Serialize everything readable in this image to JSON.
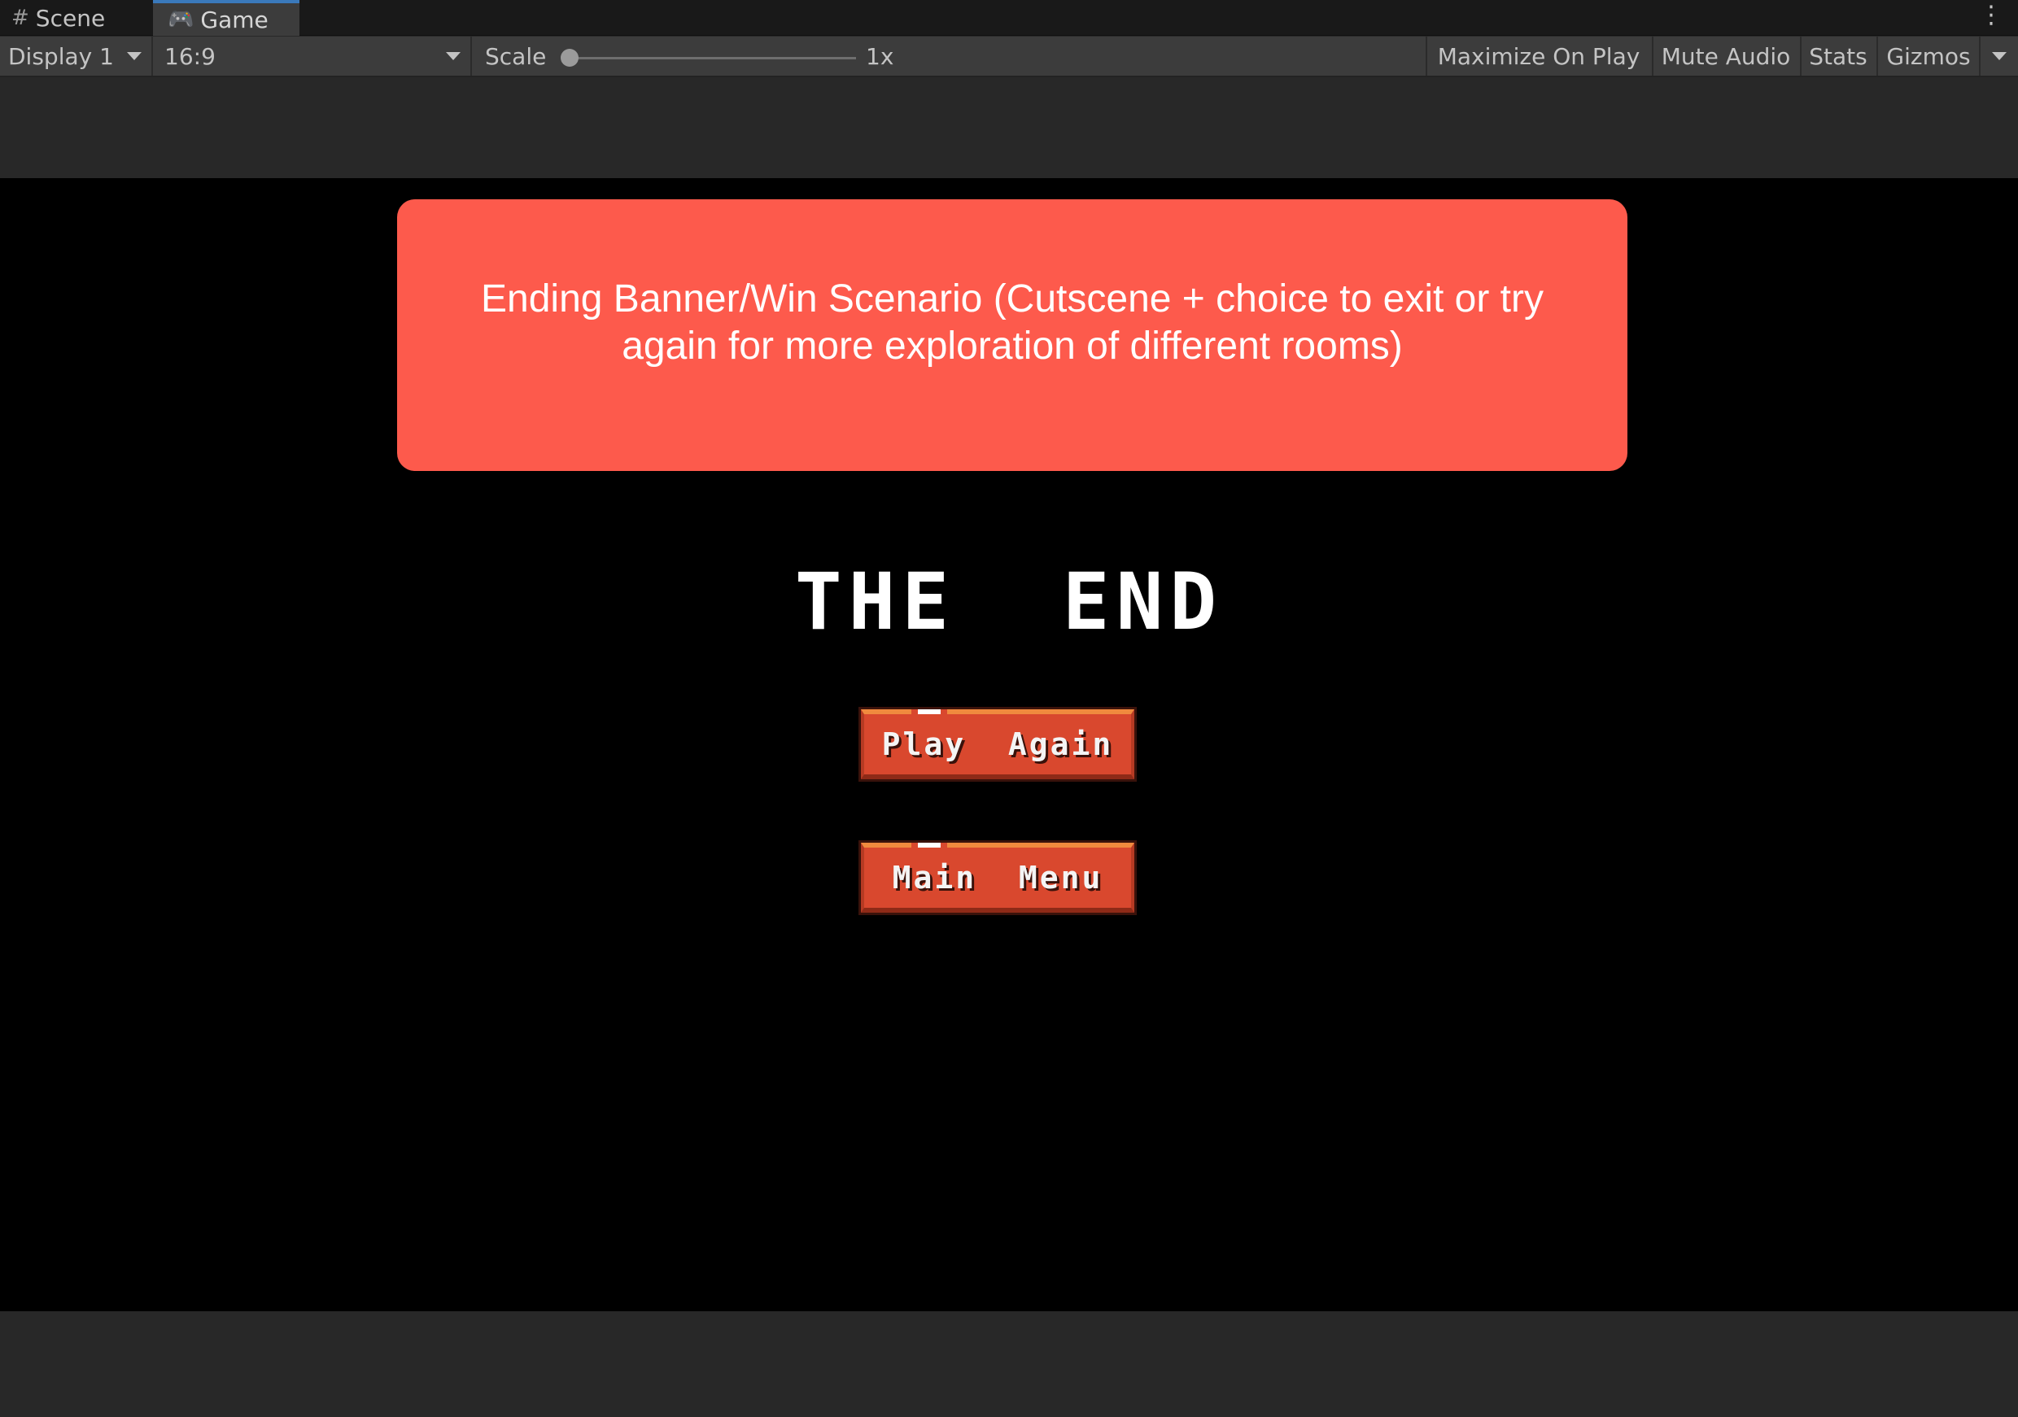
{
  "tabs": {
    "scene_label": "Scene",
    "scene_icon": "#",
    "game_label": "Game",
    "game_icon": "🎮",
    "menu_icon": "⋮"
  },
  "toolbar": {
    "display": "Display 1",
    "aspect": "16:9",
    "scale_label": "Scale",
    "scale_value": "1x",
    "scale_fraction": 0.0,
    "maximize": "Maximize On Play",
    "mute": "Mute Audio",
    "stats": "Stats",
    "gizmos": "Gizmos"
  },
  "game": {
    "banner_text": "Ending Banner/Win Scenario (Cutscene + choice to exit or try again for more exploration of different rooms)",
    "title": "THE  END",
    "play_again": "Play  Again",
    "main_menu": "Main  Menu"
  },
  "colors": {
    "banner": "#fd5a4c",
    "button": "#d9482e",
    "game_background": "#000000",
    "editor_background": "#282828",
    "active_tab_accent": "#3a79bb"
  }
}
